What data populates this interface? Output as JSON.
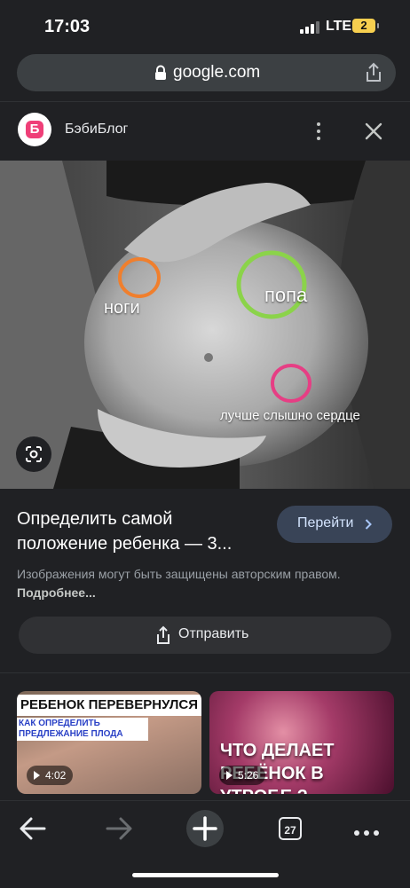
{
  "status_bar": {
    "time": "17:03",
    "network": "LTE",
    "battery": "2"
  },
  "browser": {
    "url": "google.com"
  },
  "sheet": {
    "site_name": "БэбиБлог",
    "logo_letter": "Б",
    "image_labels": {
      "legs": "ноги",
      "bottom": "попа",
      "heart": "лучше слышно сердце"
    },
    "marker_colors": {
      "legs": "#f07f2d",
      "bottom": "#8bd34a",
      "heart": "#e63e84"
    },
    "title": "Определить самой положение ребенка — 3...",
    "visit_label": "Перейти",
    "disclaimer": "Изображения могут быть защищены авторским правом.",
    "learn_more": "Подробнее...",
    "share_label": "Отправить"
  },
  "related": [
    {
      "banner": "РЕБЕНОК ПЕРЕВЕРНУЛСЯ",
      "subtitle": "КАК ОПРЕДЕЛИТЬ ПРЕДЛЕЖАНИЕ ПЛОДА",
      "duration": "4:02"
    },
    {
      "overlay": "ЧТО ДЕЛАЕТ РЕБЁНОК В УТРОБЕ ?",
      "duration": "5:26"
    }
  ],
  "toolbar": {
    "tab_count": "27"
  },
  "colors": {
    "background": "#202124",
    "accent_button": "#394457"
  }
}
